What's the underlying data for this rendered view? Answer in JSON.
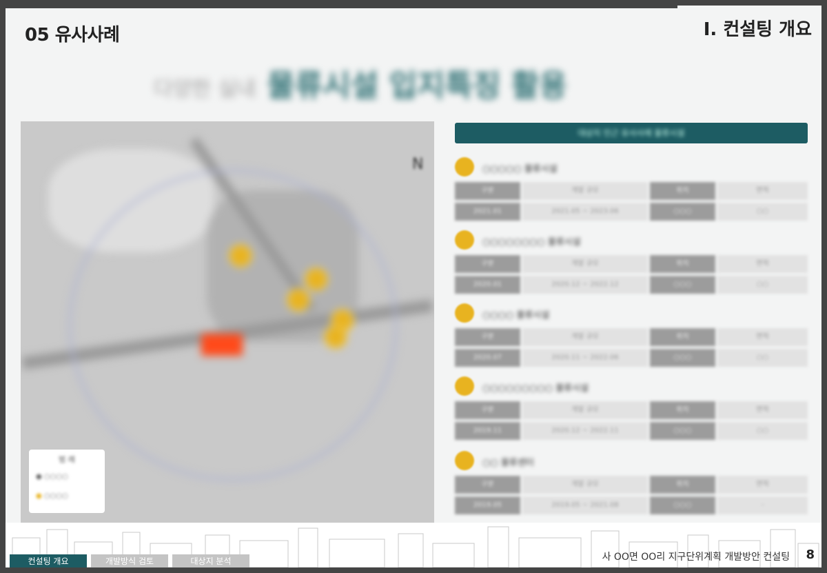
{
  "header": {
    "section_title": "05 유사사례",
    "chapter_title": "Ⅰ. 컨설팅 개요"
  },
  "headline": {
    "lead": "다양한 실내",
    "emphasis": "물류시설 입지특징 활용"
  },
  "map": {
    "north_label": "N",
    "legend_title": "범 례",
    "legend_items": [
      "○○○○",
      "○○○○"
    ]
  },
  "panel": {
    "header": "대상지 인근 유사사례 물류시설",
    "cases": [
      {
        "name": "○○○○○ 물류시설",
        "cells": [
          "구분",
          "개발 규모",
          "위치",
          "면적",
          "2021.01",
          "2021.05 ~ 2023.06",
          "○○○",
          "○○"
        ]
      },
      {
        "name": "○○○○○○○○ 물류시설",
        "cells": [
          "구분",
          "개발 규모",
          "위치",
          "면적",
          "2020.01",
          "2020.12 ~ 2022.12",
          "○○○",
          "○○"
        ]
      },
      {
        "name": "○○○○ 물류시설",
        "cells": [
          "구분",
          "개발 규모",
          "위치",
          "면적",
          "2020.07",
          "2020.11 ~ 2022.06",
          "○○○",
          "○○"
        ]
      },
      {
        "name": "○○○○○○○○○ 물류시설",
        "cells": [
          "구분",
          "개발 규모",
          "위치",
          "면적",
          "2019.11",
          "2020.12 ~ 2022.11",
          "○○○",
          "○○"
        ]
      },
      {
        "name": "○○ 물류센터",
        "cells": [
          "구분",
          "개발 규모",
          "위치",
          "면적",
          "2019.05",
          "2019.05 ~ 2021.08",
          "○○○",
          "-"
        ]
      }
    ]
  },
  "footer": {
    "tabs": [
      "컨설팅 개요",
      "개발방식 검토",
      "대상지 분석"
    ],
    "project": "사 OO면 OO리 지구단위계획 개발방안 컨설팅",
    "page": "8"
  }
}
